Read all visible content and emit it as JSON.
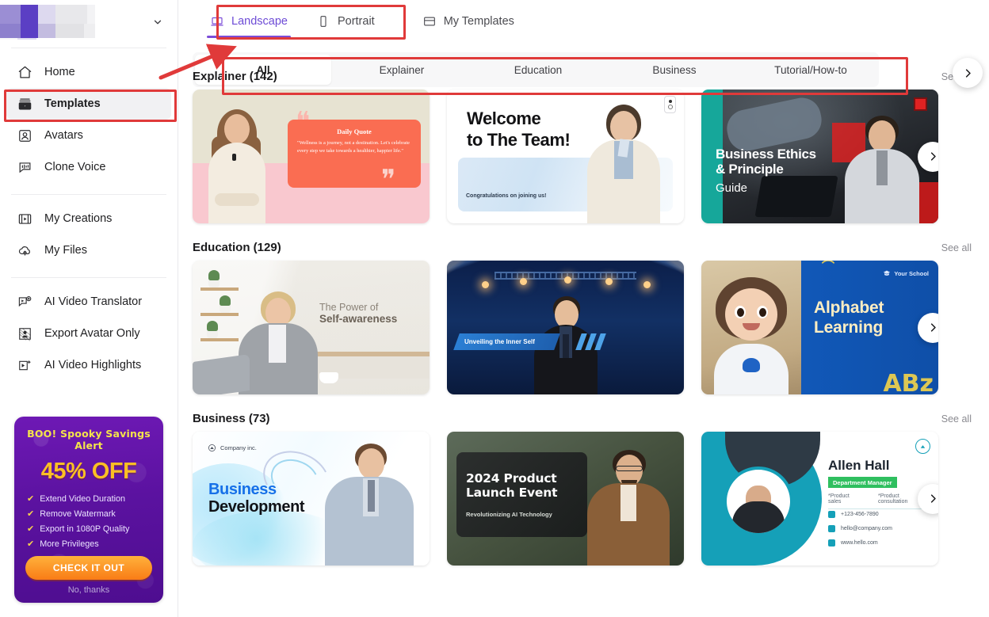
{
  "sidebar": {
    "logo_alt": "blurred-brand-logo",
    "collapse_icon": "chevron-down-icon",
    "nav_primary": [
      {
        "label": "Home",
        "icon": "home-icon",
        "active": false
      },
      {
        "label": "Templates",
        "icon": "templates-icon",
        "active": true
      },
      {
        "label": "Avatars",
        "icon": "avatar-icon",
        "active": false
      },
      {
        "label": "Clone Voice",
        "icon": "voice-icon",
        "active": false
      }
    ],
    "nav_secondary": [
      {
        "label": "My Creations",
        "icon": "creations-icon"
      },
      {
        "label": "My Files",
        "icon": "cloud-upload-icon"
      }
    ],
    "nav_tools": [
      {
        "label": "AI Video Translator",
        "icon": "translate-icon"
      },
      {
        "label": "Export Avatar Only",
        "icon": "export-avatar-icon"
      },
      {
        "label": "AI Video Highlights",
        "icon": "highlights-icon"
      }
    ],
    "promo": {
      "title": "BOO! Spooky Savings Alert",
      "discount": "45% OFF",
      "features": [
        "Extend Video Duration",
        "Remove Watermark",
        "Export in 1080P Quality",
        "More Privileges"
      ],
      "cta": "CHECK IT OUT",
      "dismiss": "No, thanks",
      "accent_yellow": "#fbbf24",
      "accent_purple": "#5b12a0"
    }
  },
  "topbar": {
    "tabs": [
      {
        "label": "Landscape",
        "icon": "laptop-icon",
        "active": true
      },
      {
        "label": "Portrait",
        "icon": "phone-icon",
        "active": false
      },
      {
        "label": "My Templates",
        "icon": "my-templates-icon",
        "active": false
      }
    ],
    "active_color": "#6d4bd6"
  },
  "categories": {
    "items": [
      {
        "label": "All",
        "active": true
      },
      {
        "label": "Explainer",
        "active": false
      },
      {
        "label": "Education",
        "active": false
      },
      {
        "label": "Business",
        "active": false
      },
      {
        "label": "Tutorial/How-to",
        "active": false
      }
    ],
    "next_icon": "chevron-right-icon"
  },
  "sections": [
    {
      "title": "Explainer (142)",
      "see_all": "See all",
      "next_icon": "chevron-right-icon",
      "cards": [
        {
          "name": "daily-quote-template",
          "heading": "Daily Quote",
          "body": "\"Wellness is a journey, not a destination. Let's celebrate every step we take towards a healthier, happier life.\""
        },
        {
          "name": "welcome-to-the-team-template",
          "heading": "Welcome\nto The Team!",
          "body": "Congratulations on joining us!"
        },
        {
          "name": "business-ethics-template",
          "heading": "Business Ethics\n& Principle",
          "body": "Guide"
        }
      ]
    },
    {
      "title": "Education (129)",
      "see_all": "See all",
      "next_icon": "chevron-right-icon",
      "cards": [
        {
          "name": "self-awareness-template",
          "heading": "The Power of",
          "body": "Self-awareness"
        },
        {
          "name": "unveiling-inner-self-template",
          "heading": "Unveiling the Inner Self",
          "body": ""
        },
        {
          "name": "alphabet-learning-template",
          "heading": "Alphabet\nLearning",
          "body": "Your School"
        }
      ]
    },
    {
      "title": "Business (73)",
      "see_all": "See all",
      "next_icon": "chevron-right-icon",
      "cards": [
        {
          "name": "business-development-template",
          "heading": "Business",
          "body": "Development",
          "extra": "Company inc."
        },
        {
          "name": "product-launch-template",
          "heading": "2024 Product\nLaunch Event",
          "body": "Revolutionizing AI Technology"
        },
        {
          "name": "allen-hall-card-template",
          "heading": "Allen Hall",
          "body": "Department Manager",
          "services": [
            "*Product sales",
            "*Product consultation"
          ],
          "phone": "+123-456-7890",
          "email": "hello@company.com",
          "website": "www.hello.com"
        }
      ]
    }
  ],
  "card_text": {
    "c1_title": "Daily Quote",
    "c1_body": "\"Wellness is a journey, not a destination. Let's celebrate every step we take towards a healthier, happier life.\"",
    "c2_line1": "Welcome",
    "c2_line2": "to The Team!",
    "c2_sub": "Congratulations on joining us!",
    "c3_line1": "Business Ethics",
    "c3_line2": "& Principle",
    "c3_line3": "Guide",
    "c4_line1": "The Power of",
    "c4_line2": "Self-awareness",
    "c5_tag": "Unveiling the Inner Self",
    "c6_line1": "Alphabet",
    "c6_line2": "Learning",
    "c6_school": "Your School",
    "c7_company": "Company inc.",
    "c7_line1": "Business",
    "c7_line2": "Development",
    "c8_line1": "2024 Product",
    "c8_line2": "Launch Event",
    "c8_sub": "Revolutionizing AI Technology",
    "c9_name": "Allen Hall",
    "c9_role": "Department Manager",
    "c9_svc1": "*Product sales",
    "c9_svc2": "*Product consultation",
    "c9_phone": "+123-456-7890",
    "c9_email": "hello@company.com",
    "c9_web": "www.hello.com"
  },
  "annotations": {
    "color": "#e03a3a",
    "boxes": [
      {
        "name": "highlight-mode-tabs"
      },
      {
        "name": "highlight-sidebar-templates"
      },
      {
        "name": "highlight-category-bar"
      }
    ],
    "arrow": {
      "name": "pointer-arrow"
    }
  }
}
